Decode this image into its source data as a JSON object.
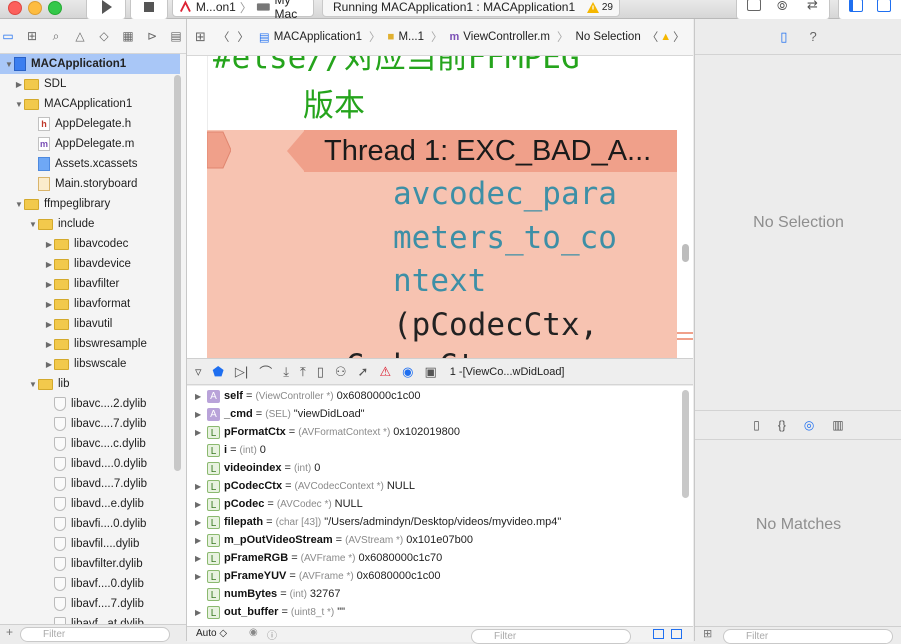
{
  "toolbar": {
    "run_icon": "play-icon",
    "stop_icon": "stop-icon",
    "scheme": "M...on1",
    "destination": "My Mac",
    "status": "Running MACApplication1 : MACApplication1",
    "warning_count": "29"
  },
  "navigator": {
    "tab_icons": [
      "folder-icon",
      "hierarchy-icon",
      "search-icon",
      "warning-icon",
      "test-icon",
      "debug-icon",
      "breakpoint-icon",
      "report-icon"
    ],
    "items": [
      {
        "label": "MACApplication1",
        "kind": "project",
        "depth": 0,
        "disc": "▼",
        "selected": true
      },
      {
        "label": "SDL",
        "kind": "folder",
        "depth": 1,
        "disc": "▶"
      },
      {
        "label": "MACApplication1",
        "kind": "folder",
        "depth": 1,
        "disc": "▼"
      },
      {
        "label": "AppDelegate.h",
        "kind": "h",
        "depth": 2,
        "disc": ""
      },
      {
        "label": "AppDelegate.m",
        "kind": "m",
        "depth": 2,
        "disc": ""
      },
      {
        "label": "Assets.xcassets",
        "kind": "assets",
        "depth": 2,
        "disc": ""
      },
      {
        "label": "Main.storyboard",
        "kind": "storyboard",
        "depth": 2,
        "disc": ""
      },
      {
        "label": "ffmpeglibrary",
        "kind": "folder",
        "depth": 1,
        "disc": "▼"
      },
      {
        "label": "include",
        "kind": "folder",
        "depth": 2,
        "disc": "▼"
      },
      {
        "label": "libavcodec",
        "kind": "folder",
        "depth": 3,
        "disc": "▶"
      },
      {
        "label": "libavdevice",
        "kind": "folder",
        "depth": 3,
        "disc": "▶"
      },
      {
        "label": "libavfilter",
        "kind": "folder",
        "depth": 3,
        "disc": "▶"
      },
      {
        "label": "libavformat",
        "kind": "folder",
        "depth": 3,
        "disc": "▶"
      },
      {
        "label": "libavutil",
        "kind": "folder",
        "depth": 3,
        "disc": "▶"
      },
      {
        "label": "libswresample",
        "kind": "folder",
        "depth": 3,
        "disc": "▶"
      },
      {
        "label": "libswscale",
        "kind": "folder",
        "depth": 3,
        "disc": "▶"
      },
      {
        "label": "lib",
        "kind": "folder",
        "depth": 2,
        "disc": "▼"
      },
      {
        "label": "libavc....2.dylib",
        "kind": "dylib",
        "depth": 3,
        "disc": ""
      },
      {
        "label": "libavc....7.dylib",
        "kind": "dylib",
        "depth": 3,
        "disc": ""
      },
      {
        "label": "libavc....c.dylib",
        "kind": "dylib",
        "depth": 3,
        "disc": ""
      },
      {
        "label": "libavd....0.dylib",
        "kind": "dylib",
        "depth": 3,
        "disc": ""
      },
      {
        "label": "libavd....7.dylib",
        "kind": "dylib",
        "depth": 3,
        "disc": ""
      },
      {
        "label": "libavd...e.dylib",
        "kind": "dylib",
        "depth": 3,
        "disc": ""
      },
      {
        "label": "libavfi....0.dylib",
        "kind": "dylib",
        "depth": 3,
        "disc": ""
      },
      {
        "label": "libavfil....dylib",
        "kind": "dylib",
        "depth": 3,
        "disc": ""
      },
      {
        "label": "libavfilter.dylib",
        "kind": "dylib",
        "depth": 3,
        "disc": ""
      },
      {
        "label": "libavf....0.dylib",
        "kind": "dylib",
        "depth": 3,
        "disc": ""
      },
      {
        "label": "libavf....7.dylib",
        "kind": "dylib",
        "depth": 3,
        "disc": ""
      },
      {
        "label": "libavf...at.dylib",
        "kind": "dylib",
        "depth": 3,
        "disc": ""
      }
    ],
    "filter_placeholder": "Filter"
  },
  "jumpbar": {
    "crumbs": [
      "MACApplication1",
      "M...1",
      "ViewController.m",
      "No Selection"
    ]
  },
  "editor": {
    "line1": "#else//对应当前FFMPEG",
    "line2": "版本",
    "thread_message": "Thread 1: EXC_BAD_A...",
    "code_lines": [
      "avcodec_para",
      "meters_to_co",
      "ntext",
      "(pCodecCtx,",
      "    pCodecCtx,"
    ]
  },
  "debugbar": {
    "frame_label": "1 -[ViewCo...wDidLoad]"
  },
  "variables": [
    {
      "disc": "▶",
      "badge": "A",
      "name": "self",
      "type": "(ViewController *)",
      "value": "0x6080000c1c00"
    },
    {
      "disc": "▶",
      "badge": "A",
      "name": "_cmd",
      "type": "(SEL)",
      "value": "\"viewDidLoad\""
    },
    {
      "disc": "▶",
      "badge": "L",
      "name": "pFormatCtx",
      "type": "(AVFormatContext *)",
      "value": "0x102019800"
    },
    {
      "disc": "",
      "badge": "L",
      "name": "i",
      "type": "(int)",
      "value": "0"
    },
    {
      "disc": "",
      "badge": "L",
      "name": "videoindex",
      "type": "(int)",
      "value": "0"
    },
    {
      "disc": "▶",
      "badge": "L",
      "name": "pCodecCtx",
      "type": "(AVCodecContext *)",
      "value": "NULL"
    },
    {
      "disc": "▶",
      "badge": "L",
      "name": "pCodec",
      "type": "(AVCodec *)",
      "value": "NULL"
    },
    {
      "disc": "▶",
      "badge": "L",
      "name": "filepath",
      "type": "(char [43])",
      "value": "\"/Users/admindyn/Desktop/videos/myvideo.mp4\""
    },
    {
      "disc": "▶",
      "badge": "L",
      "name": "m_pOutVideoStream",
      "type": "(AVStream *)",
      "value": "0x101e07b00"
    },
    {
      "disc": "▶",
      "badge": "L",
      "name": "pFrameRGB",
      "type": "(AVFrame *)",
      "value": "0x6080000c1c70"
    },
    {
      "disc": "▶",
      "badge": "L",
      "name": "pFrameYUV",
      "type": "(AVFrame *)",
      "value": "0x6080000c1c00"
    },
    {
      "disc": "",
      "badge": "L",
      "name": "numBytes",
      "type": "(int)",
      "value": "32767"
    },
    {
      "disc": "▶",
      "badge": "L",
      "name": "out_buffer",
      "type": "(uint8_t *)",
      "value": "\"\""
    }
  ],
  "vars_footer": {
    "mode": "Auto ◇",
    "filter_placeholder": "Filter"
  },
  "inspector": {
    "no_selection": "No Selection",
    "no_matches": "No Matches",
    "filter_placeholder": "Filter"
  },
  "colors": {
    "thread_banner": "#f7c3b1",
    "thread_head": "#f0a08a",
    "code_green": "#25a41c",
    "code_teal": "#3d8fa6",
    "selection": "#a9c7f7",
    "accent": "#1f6ff0"
  }
}
